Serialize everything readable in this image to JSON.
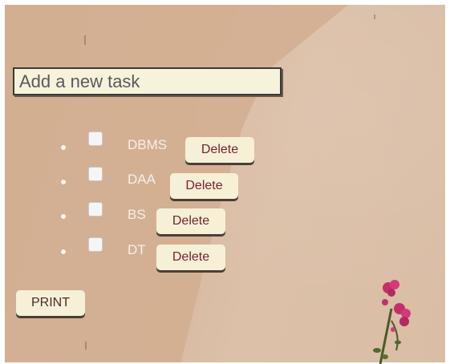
{
  "new_task": {
    "placeholder": "Add a new task",
    "value": ""
  },
  "tasks": [
    {
      "label": "DBMS",
      "done": false,
      "delete_label": "Delete"
    },
    {
      "label": "DAA",
      "done": false,
      "delete_label": "Delete"
    },
    {
      "label": "BS",
      "done": false,
      "delete_label": "Delete"
    },
    {
      "label": "DT",
      "done": false,
      "delete_label": "Delete"
    }
  ],
  "print_label": "PRINT",
  "colors": {
    "wall": "#d7b69c",
    "wall_shadow": "#d2ae91",
    "input_bg": "#f6f2dc",
    "button_bg": "#f6f0d6",
    "button_text": "#7a2230",
    "task_text": "#f4f0ea",
    "flower": "#c2306a"
  }
}
